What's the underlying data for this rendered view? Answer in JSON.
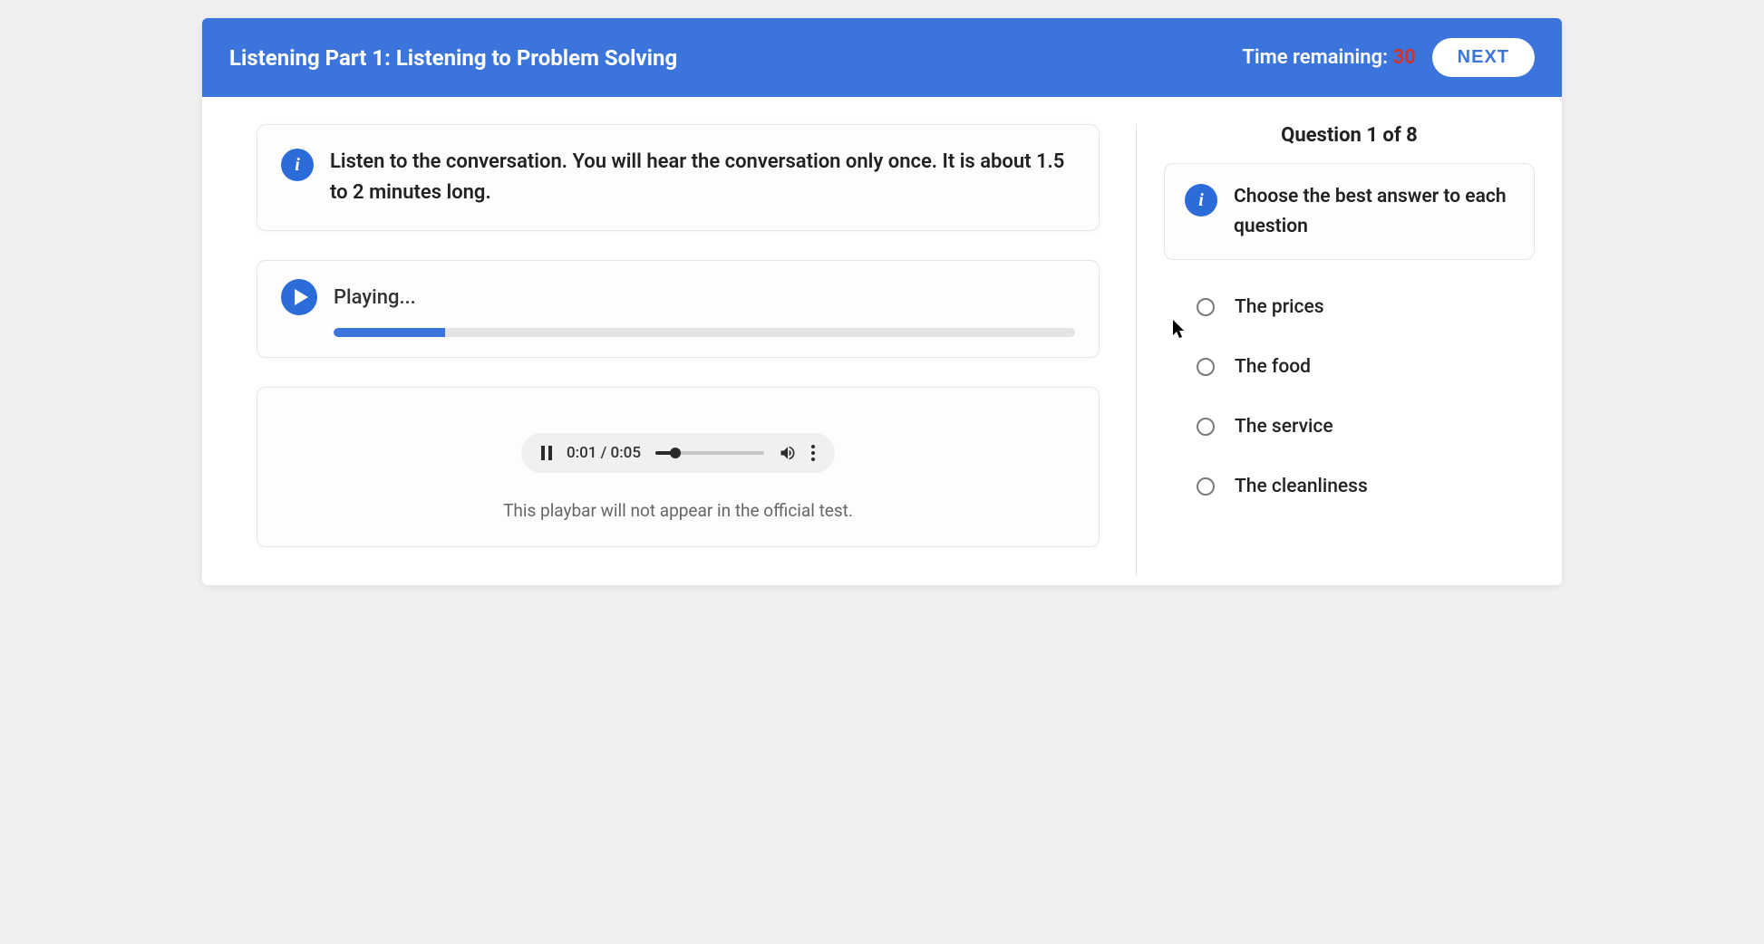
{
  "header": {
    "title": "Listening Part 1: Listening to Problem Solving",
    "time_label": "Time remaining: ",
    "time_value": "30",
    "next_label": "NEXT"
  },
  "instructions": {
    "text": "Listen to the conversation. You will hear the conversation only once. It is about 1.5 to 2 minutes long."
  },
  "player": {
    "status": "Playing...",
    "progress_percent": 15
  },
  "playbar": {
    "time": "0:01 / 0:05",
    "note": "This playbar will not appear in the official test."
  },
  "question": {
    "counter": "Question 1 of 8",
    "prompt": "Choose the best answer to each question",
    "options": [
      "The prices",
      "The food",
      "The service",
      "The cleanliness"
    ]
  }
}
